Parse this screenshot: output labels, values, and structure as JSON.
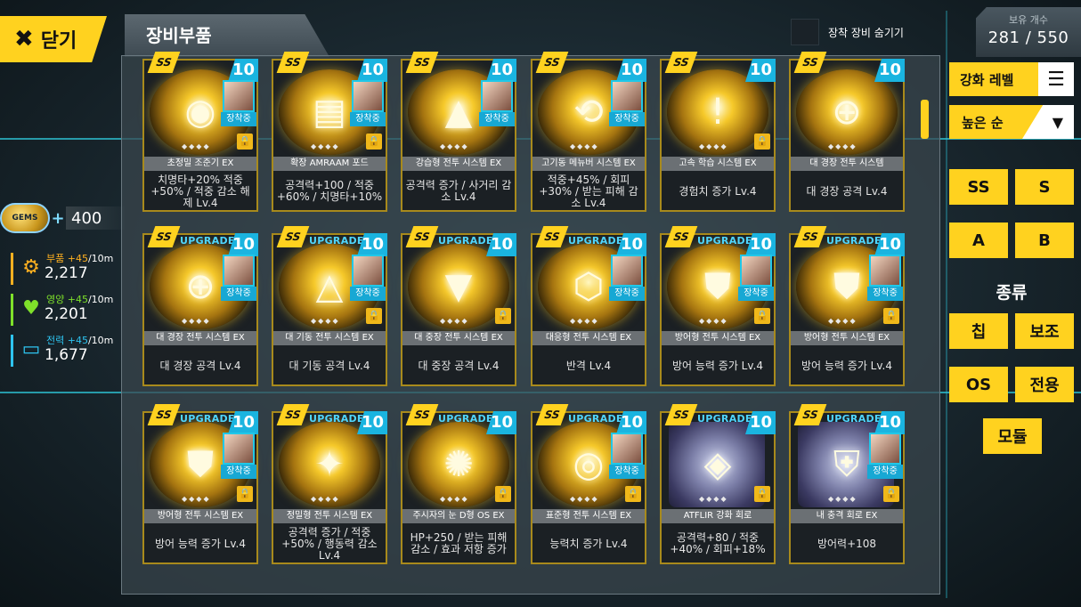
{
  "close": {
    "label": "닫기"
  },
  "header": {
    "title": "장비부품",
    "hide_equipped": "장착 장비 숨기기"
  },
  "owned": {
    "label": "보유 개수",
    "value": "281 / 550"
  },
  "resources": {
    "gem": {
      "value": "400",
      "badge": "GEMS"
    },
    "items": [
      {
        "name": "부품",
        "rate": "+45",
        "unit": "/10m",
        "amount": "2,217",
        "color": "#ffb020"
      },
      {
        "name": "영양",
        "rate": "+45",
        "unit": "/10m",
        "amount": "2,201",
        "color": "#7ee02a"
      },
      {
        "name": "전력",
        "rate": "+45",
        "unit": "/10m",
        "amount": "1,677",
        "color": "#2ec4f0"
      }
    ]
  },
  "filters": {
    "enhance_level": "강화 레벨",
    "sort": "높은 순",
    "grades": [
      "SS",
      "S",
      "A",
      "B"
    ],
    "category_label": "종류",
    "categories": [
      "칩",
      "보조",
      "OS",
      "전용",
      "모듈"
    ]
  },
  "common": {
    "equipped": "장착중",
    "upgrade": "UPGRADE",
    "level": "10",
    "tag": "SS"
  },
  "cards": [
    {
      "name": "초정밀 조준기 EX",
      "desc": "치명타+20% 적중+50% / 적중 감소 해제 Lv.4",
      "upgrade": false,
      "equipped": true,
      "lock": true,
      "glyph": "◉"
    },
    {
      "name": "확장 AMRAAM 포드",
      "desc": "공격력+100 / 적중+60% / 치명타+10%",
      "upgrade": false,
      "equipped": true,
      "lock": true,
      "glyph": "▤"
    },
    {
      "name": "강습형 전투 시스템 EX",
      "desc": "공격력 증가 / 사거리 감소 Lv.4",
      "upgrade": false,
      "equipped": true,
      "lock": false,
      "glyph": "▲"
    },
    {
      "name": "고기동 메뉴버 시스템 EX",
      "desc": "적중+45% / 회피+30% / 받는 피해 감소 Lv.4",
      "upgrade": false,
      "equipped": true,
      "lock": false,
      "glyph": "⟲"
    },
    {
      "name": "고속 학습 시스템 EX",
      "desc": "경험치 증가 Lv.4",
      "upgrade": false,
      "equipped": false,
      "lock": true,
      "glyph": "!"
    },
    {
      "name": "대 경장 전투 시스템",
      "desc": "대 경장 공격 Lv.4",
      "upgrade": false,
      "equipped": false,
      "lock": false,
      "glyph": "⊕"
    },
    {
      "name": "대 경장 전투 시스템 EX",
      "desc": "대 경장 공격 Lv.4",
      "upgrade": true,
      "equipped": true,
      "lock": false,
      "glyph": "⊕"
    },
    {
      "name": "대 기동 전투 시스템 EX",
      "desc": "대 기동 공격 Lv.4",
      "upgrade": true,
      "equipped": true,
      "lock": true,
      "glyph": "△"
    },
    {
      "name": "대 중장 전투 시스템 EX",
      "desc": "대 중장 공격 Lv.4",
      "upgrade": true,
      "equipped": false,
      "lock": true,
      "glyph": "▼"
    },
    {
      "name": "대응형 전투 시스템 EX",
      "desc": "반격 Lv.4",
      "upgrade": true,
      "equipped": true,
      "lock": false,
      "glyph": "⬡"
    },
    {
      "name": "방어형 전투 시스템 EX",
      "desc": "방어 능력 증가 Lv.4",
      "upgrade": true,
      "equipped": true,
      "lock": true,
      "glyph": "⛊"
    },
    {
      "name": "방어형 전투 시스템 EX",
      "desc": "방어 능력 증가 Lv.4",
      "upgrade": true,
      "equipped": true,
      "lock": true,
      "glyph": "⛊"
    },
    {
      "name": "방어형 전투 시스템 EX",
      "desc": "방어 능력 증가 Lv.4",
      "upgrade": true,
      "equipped": true,
      "lock": true,
      "glyph": "⛊"
    },
    {
      "name": "정밀형 전투 시스템 EX",
      "desc": "공격력 증가 / 적중+50% / 행동력 감소 Lv.4",
      "upgrade": true,
      "equipped": false,
      "lock": false,
      "glyph": "✦"
    },
    {
      "name": "주시자의 눈 D형 OS EX",
      "desc": "HP+250 / 받는 피해 감소 / 효과 저항 증가",
      "upgrade": true,
      "equipped": false,
      "lock": true,
      "glyph": "✺"
    },
    {
      "name": "표준형 전투 시스템 EX",
      "desc": "능력치 증가 Lv.4",
      "upgrade": true,
      "equipped": true,
      "lock": true,
      "glyph": "◎"
    },
    {
      "name": "ATFLIR 강화 회로",
      "desc": "공격력+80 / 적중+40% / 회피+18%",
      "upgrade": true,
      "equipped": false,
      "lock": true,
      "glyph": "◈",
      "style": "module"
    },
    {
      "name": "내 충격 회로 EX",
      "desc": "방어력+108",
      "upgrade": true,
      "equipped": true,
      "lock": true,
      "glyph": "⛨",
      "style": "module"
    }
  ]
}
